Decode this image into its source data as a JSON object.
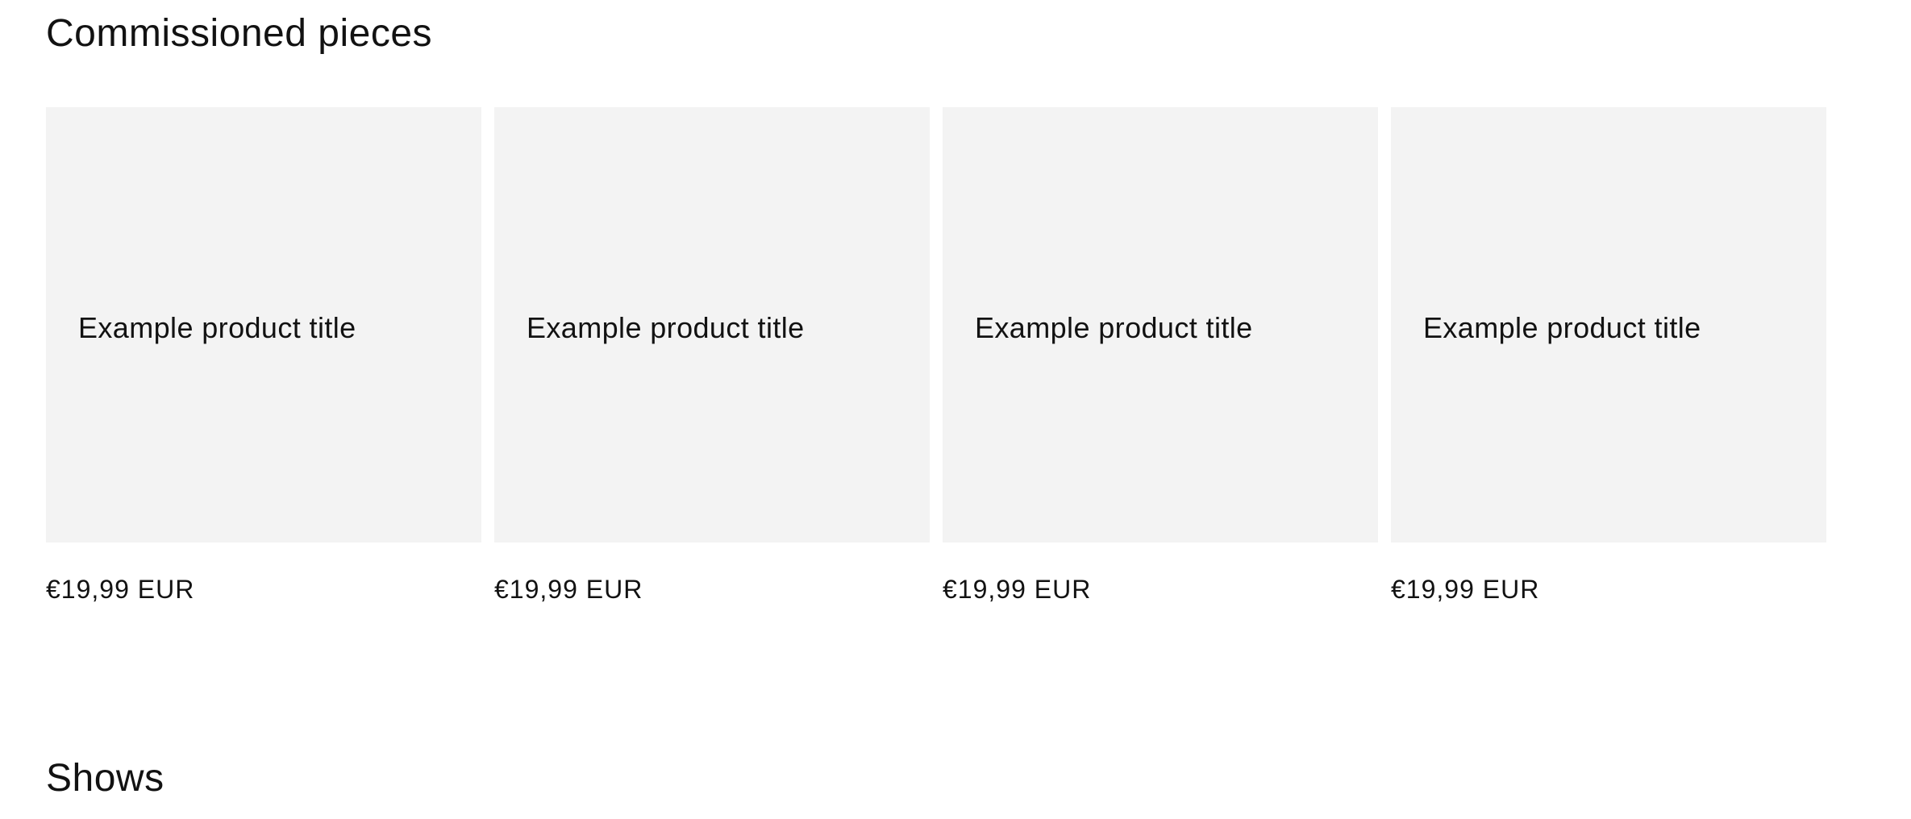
{
  "sections": {
    "commissioned": {
      "heading": "Commissioned pieces",
      "products": [
        {
          "title": "Example product title",
          "price": "€19,99 EUR"
        },
        {
          "title": "Example product title",
          "price": "€19,99 EUR"
        },
        {
          "title": "Example product title",
          "price": "€19,99 EUR"
        },
        {
          "title": "Example product title",
          "price": "€19,99 EUR"
        }
      ]
    },
    "shows": {
      "heading": "Shows"
    }
  },
  "colors": {
    "text": "#121212",
    "card_background": "#f3f3f3",
    "page_background": "#ffffff"
  }
}
